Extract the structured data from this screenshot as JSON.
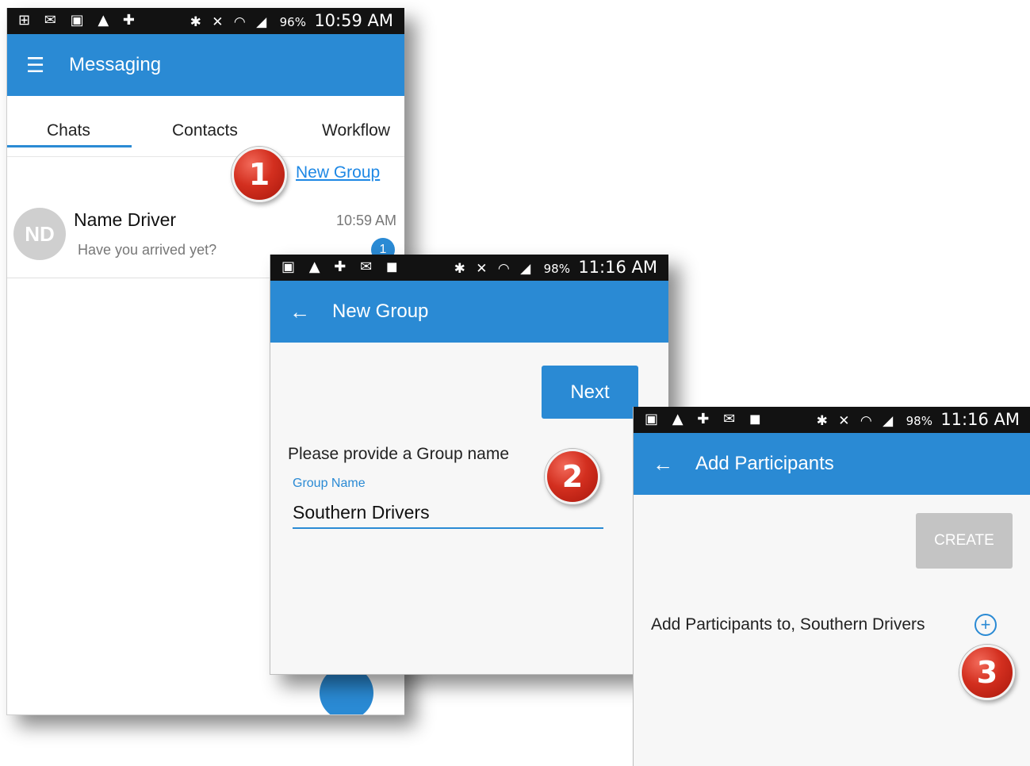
{
  "screen1": {
    "status": {
      "icons": "⊞ ✉ ▣ ▲ ✚",
      "sys": "✱ ✕ ◠ ◢",
      "battery": "96%",
      "time": "10:59 AM"
    },
    "appbar": {
      "menu_icon": "☰",
      "title": "Messaging"
    },
    "tabs": [
      "Chats",
      "Contacts",
      "Workflow"
    ],
    "new_group_link": "New Group",
    "chat": {
      "initials": "ND",
      "name": "Name Driver",
      "preview": "Have you arrived yet?",
      "time": "10:59 AM",
      "unread": "1"
    }
  },
  "screen2": {
    "status": {
      "icons": "▣ ▲ ✚ ✉ ◼",
      "sys": "✱ ✕ ◠ ◢",
      "battery": "98%",
      "time": "11:16 AM"
    },
    "appbar": {
      "back_icon": "←",
      "title": "New Group"
    },
    "next_button": "Next",
    "prompt": "Please provide a Group name",
    "field_label": "Group Name",
    "field_value": "Southern Drivers"
  },
  "screen3": {
    "status": {
      "icons": "▣ ▲ ✚ ✉ ◼",
      "sys": "✱ ✕ ◠ ◢",
      "battery": "98%",
      "time": "11:16 AM"
    },
    "appbar": {
      "back_icon": "←",
      "title": "Add Participants"
    },
    "create_button": "CREATE",
    "participants_text": "Add Participants to, Southern Drivers",
    "add_icon": "+"
  },
  "badges": [
    "1",
    "2",
    "3"
  ],
  "colors": {
    "accent": "#2a8ad4",
    "badge": "#d32f1f",
    "disabled": "#c4c4c4"
  }
}
